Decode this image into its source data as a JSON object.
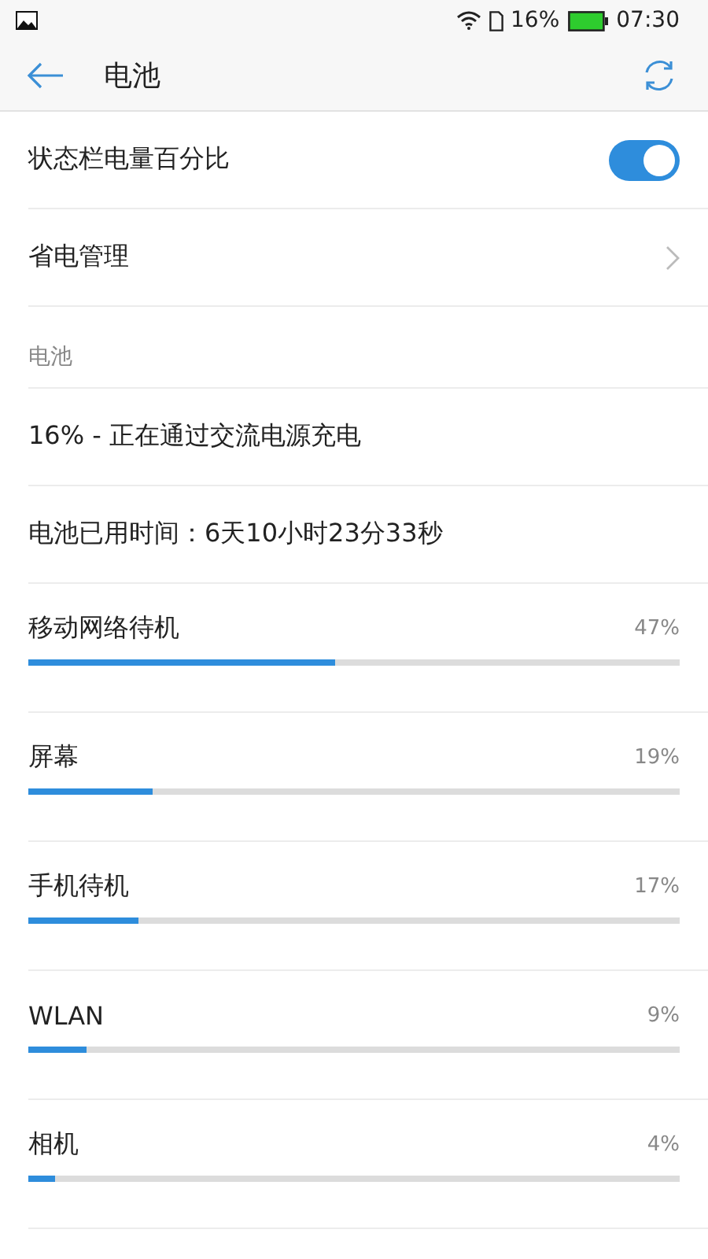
{
  "status_bar": {
    "battery_text": "16%",
    "time": "07:30"
  },
  "header": {
    "title": "电池"
  },
  "settings": [
    {
      "kind": "toggle",
      "label": "状态栏电量百分比",
      "on": true
    },
    {
      "kind": "link",
      "label": "省电管理"
    }
  ],
  "section_title": "电池",
  "info": [
    "16% - 正在通过交流电源充电",
    "电池已用时间：6天10小时23分33秒"
  ],
  "usage": [
    {
      "name": "移动网络待机",
      "percent": "47%",
      "level": 0.47
    },
    {
      "name": "屏幕",
      "percent": "19%",
      "level": 0.19
    },
    {
      "name": "手机待机",
      "percent": "17%",
      "level": 0.17
    },
    {
      "name": "WLAN",
      "percent": "9%",
      "level": 0.09
    },
    {
      "name": "相机",
      "percent": "4%",
      "level": 0.04
    }
  ]
}
